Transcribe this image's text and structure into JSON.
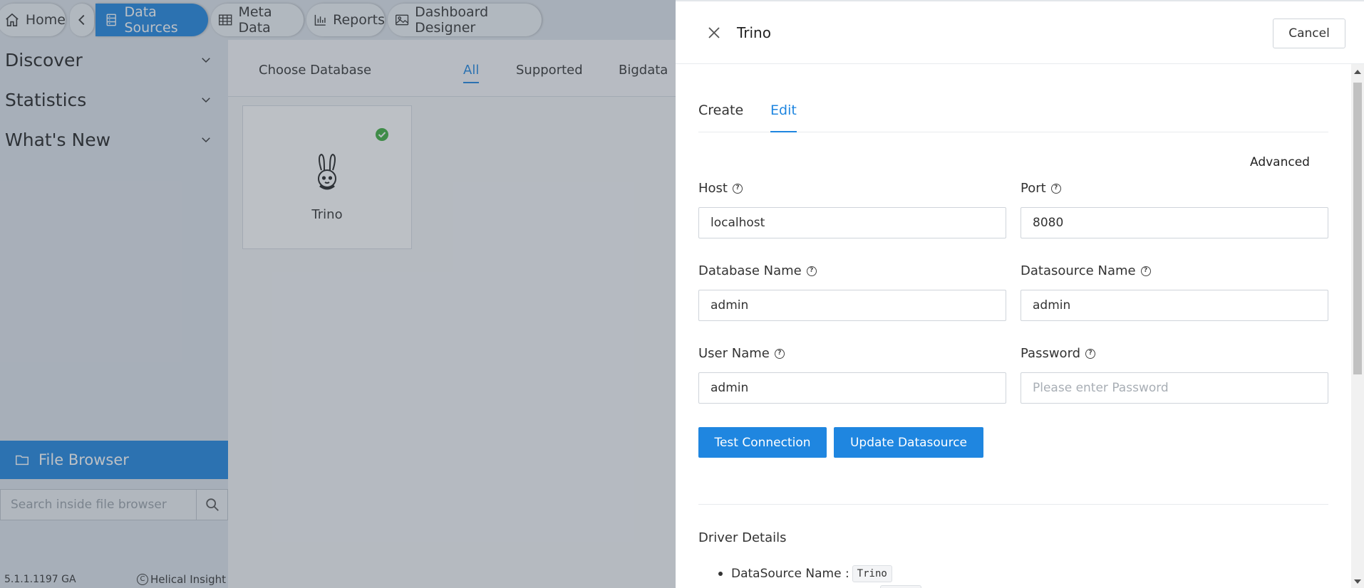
{
  "nav": {
    "home": "Home",
    "data_sources": "Data Sources",
    "meta_data": "Meta Data",
    "reports": "Reports",
    "dashboard_designer": "Dashboard Designer"
  },
  "sidebar": {
    "items": [
      {
        "label": "Discover"
      },
      {
        "label": "Statistics"
      },
      {
        "label": "What's New"
      }
    ],
    "file_browser": "File Browser",
    "search_placeholder": "Search inside file browser",
    "version": "5.1.1.1197 GA",
    "brand": "Helical Insight"
  },
  "content": {
    "choose_database": "Choose Database",
    "filter_tabs": [
      "All",
      "Supported",
      "Bigdata"
    ],
    "active_filter": "All",
    "card": {
      "name": "Trino",
      "selected": true
    }
  },
  "drawer": {
    "title": "Trino",
    "cancel": "Cancel",
    "tabs": [
      "Create",
      "Edit"
    ],
    "active_tab": "Edit",
    "advanced": "Advanced",
    "fields": {
      "host": {
        "label": "Host",
        "value": "localhost"
      },
      "port": {
        "label": "Port",
        "value": "8080"
      },
      "database_name": {
        "label": "Database Name",
        "value": "admin"
      },
      "datasource_name": {
        "label": "Datasource Name",
        "value": "admin"
      },
      "user_name": {
        "label": "User Name",
        "value": "admin"
      },
      "password": {
        "label": "Password",
        "value": "",
        "placeholder": "Please enter Password"
      }
    },
    "test_connection": "Test Connection",
    "update_datasource": "Update Datasource",
    "driver_details": "Driver Details",
    "driver_items": [
      {
        "label": "DataSource Name :",
        "value": "Trino"
      }
    ]
  },
  "colors": {
    "accent": "#1f86e0",
    "success": "#3cae3c"
  }
}
